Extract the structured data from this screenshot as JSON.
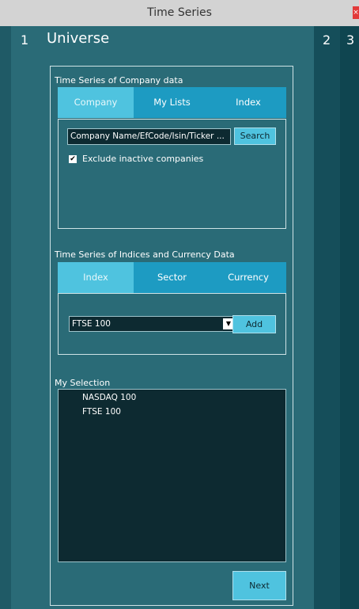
{
  "window": {
    "title": "Time Series",
    "close": "×"
  },
  "steps": [
    {
      "number": "1",
      "title": "Universe"
    },
    {
      "number": "2"
    },
    {
      "number": "3"
    }
  ],
  "company_section": {
    "label": "Time Series of Company data",
    "tabs": [
      "Company",
      "My Lists",
      "Index"
    ],
    "active_tab": "Company",
    "search_placeholder": "Company Name/EfCode/Isin/Ticker ...",
    "search_button": "Search",
    "exclude_inactive_label": "Exclude inactive companies",
    "exclude_inactive_checked": true
  },
  "indices_section": {
    "label": "Time Series of Indices and Currency Data",
    "tabs": [
      "Index",
      "Sector",
      "Currency"
    ],
    "active_tab": "Index",
    "selected_index": "FTSE 100",
    "add_button": "Add"
  },
  "selection": {
    "label": "My Selection",
    "items": [
      "NASDAQ 100",
      "FTSE 100"
    ]
  },
  "next_button": "Next",
  "colors": {
    "accent": "#1d9bc2",
    "accent_active": "#4fc3df",
    "background": "#2a6b77"
  }
}
